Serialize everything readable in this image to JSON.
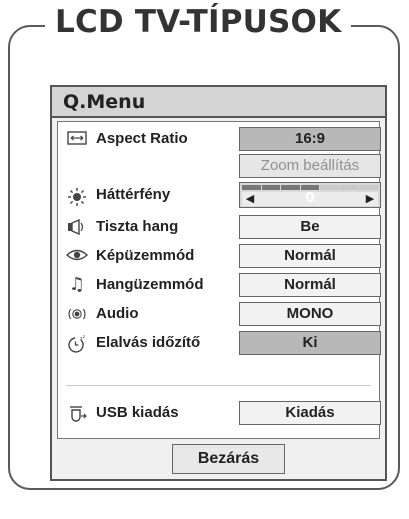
{
  "heading": "LCD TV-TÍPUSOK",
  "menu": {
    "title": "Q.Menu",
    "items": [
      {
        "label": "Aspect Ratio",
        "value": "16:9",
        "icon": "aspect-ratio-icon"
      },
      {
        "label": "",
        "value": "Zoom beállítás",
        "icon": ""
      },
      {
        "label": "Háttérfény",
        "value": "0",
        "icon": "backlight-icon"
      },
      {
        "label": "Tiszta hang",
        "value": "Be",
        "icon": "clear-voice-icon"
      },
      {
        "label": "Képüzemmód",
        "value": "Normál",
        "icon": "picture-mode-icon"
      },
      {
        "label": "Hangüzemmód",
        "value": "Normál",
        "icon": "sound-mode-icon"
      },
      {
        "label": "Audio",
        "value": "MONO",
        "icon": "audio-icon"
      },
      {
        "label": "Elalvás időzítő",
        "value": "Ki",
        "icon": "sleep-timer-icon"
      },
      {
        "label": "USB kiadás",
        "value": "Kiadás",
        "icon": "usb-eject-icon"
      }
    ],
    "close_label": "Bezárás"
  }
}
